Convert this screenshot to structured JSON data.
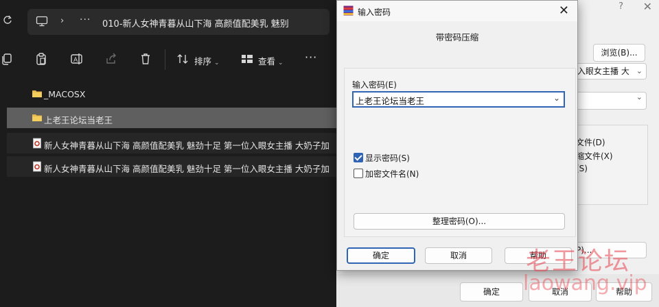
{
  "explorer": {
    "address": {
      "path": "010-新人女神青暮从山下海 高颜值配美乳 魅别"
    },
    "toolbar": {
      "sort_label": "排序",
      "view_label": "查看"
    },
    "files": [
      {
        "name": "_MACOSX",
        "type": "folder"
      },
      {
        "name": "上老王论坛当老王",
        "type": "folder"
      },
      {
        "name": "新人女神青暮从山下海 高颜值配美乳 魅劲十足 第一位入眼女主播 大奶子加",
        "type": "archive"
      },
      {
        "name": "新人女神青暮从山下海 高颜值配美乳 魅劲十足 第一位入眼女主播 大奶子加",
        "type": "archive"
      }
    ]
  },
  "background_dialog": {
    "browse_label": "浏览(B)...",
    "combo1_value": "入眼女主播 大",
    "group_items": [
      "文件(D)",
      "缩文件(X)",
      "(S)"
    ],
    "small_button_label": "P)...",
    "ok_label": "确定",
    "cancel_label": "取消",
    "help_label": "帮助"
  },
  "password_dialog": {
    "title": "输入密码",
    "header": "带密码压缩",
    "field_label": "输入密码(E)",
    "password_value": "上老王论坛当老王",
    "show_password_label": "显示密码(S)",
    "show_password_checked": true,
    "encrypt_names_label": "加密文件名(N)",
    "encrypt_names_checked": false,
    "organize_label": "整理密码(O)...",
    "ok_label": "确定",
    "cancel_label": "取消",
    "help_label": "帮助"
  },
  "watermark": {
    "text": "老王论坛",
    "url": "laowang.vip"
  }
}
